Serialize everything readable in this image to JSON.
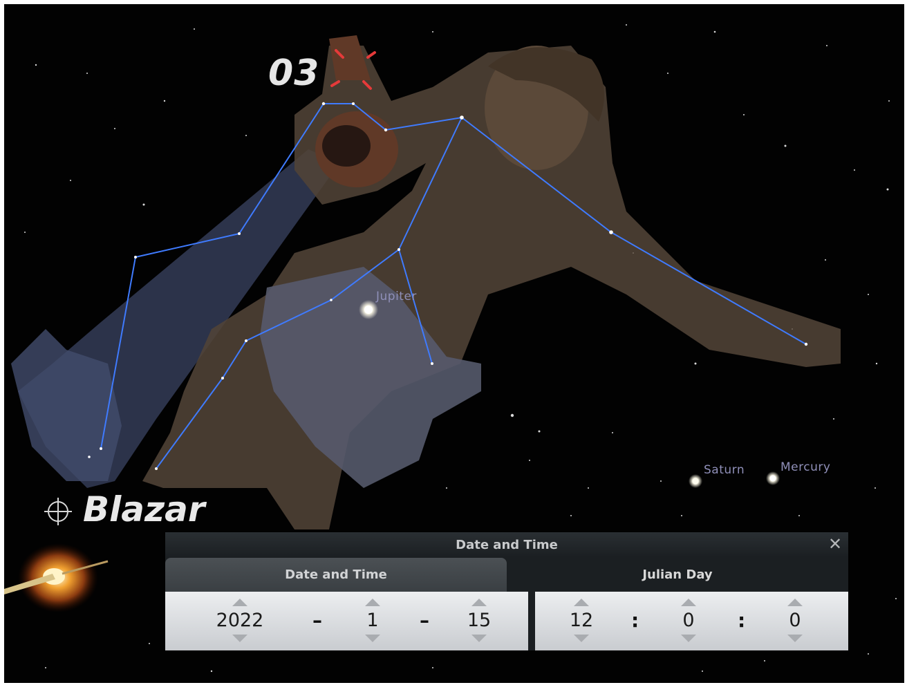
{
  "overlay": {
    "episode": "03",
    "brand": "Blazar"
  },
  "planets": [
    {
      "name": "Jupiter"
    },
    {
      "name": "Saturn"
    },
    {
      "name": "Mercury"
    }
  ],
  "dialog": {
    "title": "Date and Time",
    "tabs": [
      "Date and Time",
      "Julian Day"
    ],
    "date": {
      "year": "2022",
      "month": "1",
      "day": "15",
      "sep": "–"
    },
    "time": {
      "hour": "12",
      "minute": "0",
      "second": "0",
      "sep": ":"
    }
  },
  "colors": {
    "constellation_line": "#3f7bff",
    "sky": "#020202",
    "accent_red": "#e53a3a"
  }
}
